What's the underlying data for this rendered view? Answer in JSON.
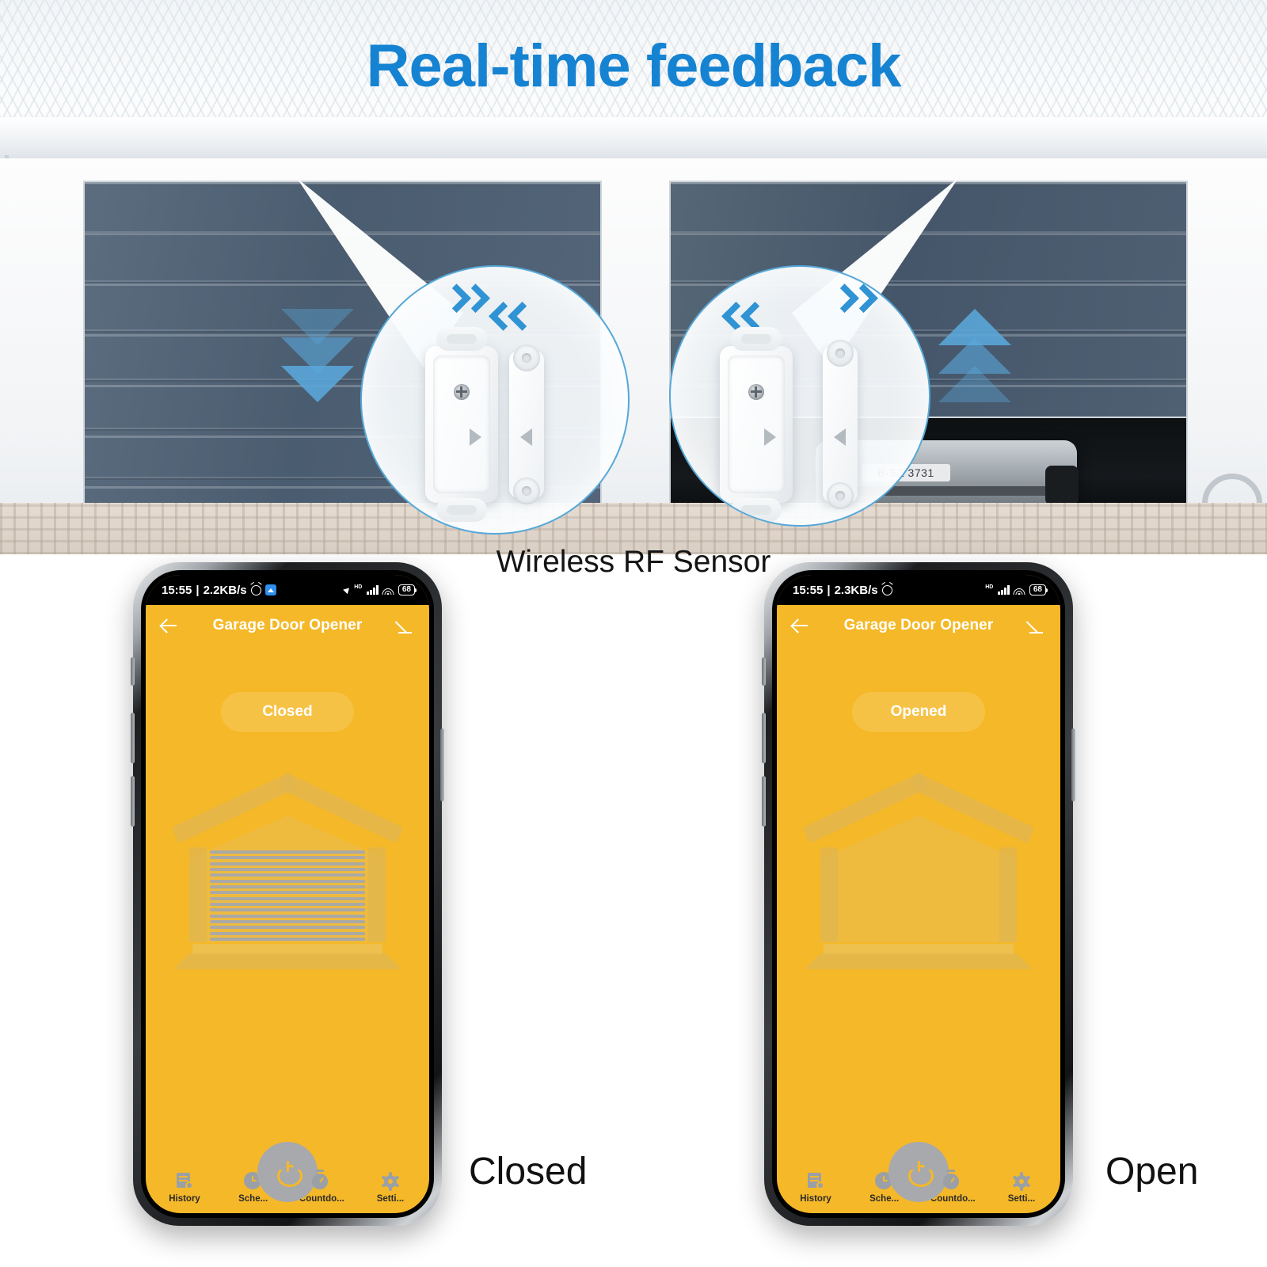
{
  "headline": "Real-time feedback",
  "sensor_caption": "Wireless RF Sensor",
  "colors": {
    "headline_blue": "#1583D2",
    "app_yellow": "#F5B828",
    "chevron_blue": "#2F93D4",
    "door_gray": "#4A5C6F"
  },
  "scene": {
    "left_door_state": "closing",
    "right_door_state": "opening",
    "car_plate": "B·SZ 3731"
  },
  "phones": [
    {
      "id": "phone-closed",
      "outer_label": "Closed",
      "status_bar": {
        "time": "15:55",
        "network_speed": "2.2KB/s",
        "alarm_icon": "alarm-clock-icon",
        "app_icon": "app-notification-icon",
        "location_icon": "location-arrow-icon",
        "network_type": "HD",
        "signal_icon": "signal-bars-icon",
        "wifi_icon": "wifi-icon",
        "battery": "68"
      },
      "header": {
        "back_icon": "back-arrow-icon",
        "title": "Garage Door Opener",
        "edit_icon": "pencil-edit-icon"
      },
      "status_pill": "Closed",
      "illustration": "garage-door-closed",
      "bottom_nav": [
        {
          "label": "History",
          "icon": "history-icon"
        },
        {
          "label": "Sche...",
          "icon": "clock-icon"
        },
        {
          "label": "Countdo...",
          "icon": "timer-icon"
        },
        {
          "label": "Setti...",
          "icon": "gear-icon"
        }
      ],
      "power_button": "power-icon"
    },
    {
      "id": "phone-open",
      "outer_label": "Open",
      "status_bar": {
        "time": "15:55",
        "network_speed": "2.3KB/s",
        "alarm_icon": "alarm-clock-icon",
        "app_icon": "",
        "location_icon": "",
        "network_type": "HD",
        "signal_icon": "signal-bars-icon",
        "wifi_icon": "wifi-icon",
        "battery": "68"
      },
      "header": {
        "back_icon": "back-arrow-icon",
        "title": "Garage Door Opener",
        "edit_icon": "pencil-edit-icon"
      },
      "status_pill": "Opened",
      "illustration": "garage-door-open",
      "bottom_nav": [
        {
          "label": "History",
          "icon": "history-icon"
        },
        {
          "label": "Sche...",
          "icon": "clock-icon"
        },
        {
          "label": "Countdo...",
          "icon": "timer-icon"
        },
        {
          "label": "Setti...",
          "icon": "gear-icon"
        }
      ],
      "power_button": "power-icon"
    }
  ]
}
